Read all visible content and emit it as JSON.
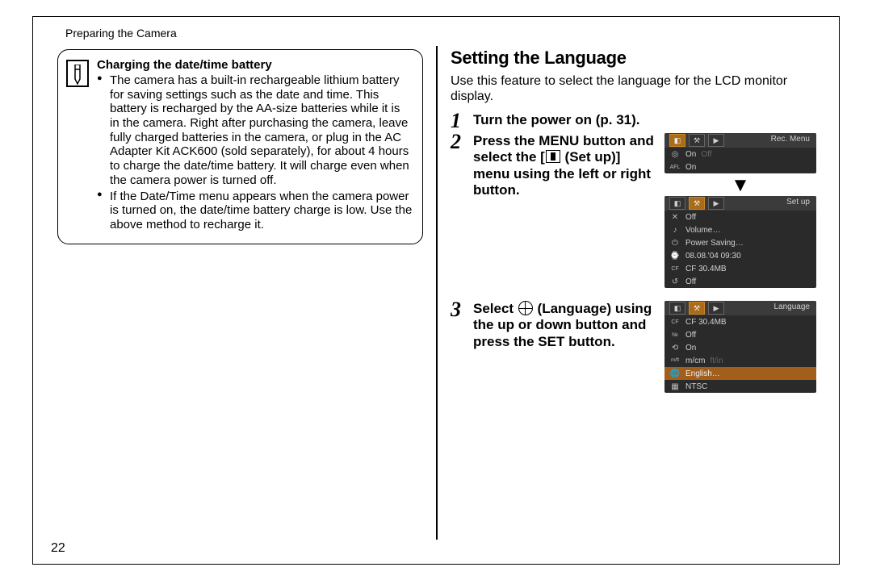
{
  "header": "Preparing the Camera",
  "page_number": "22",
  "note": {
    "title": "Charging the date/time battery",
    "items": [
      "The camera has a built-in rechargeable lithium battery for saving settings such as the date and time. This battery is recharged by the AA-size batteries while it is in the camera. Right after purchasing the camera, leave fully charged batteries in the camera, or plug in the AC Adapter Kit ACK600 (sold separately), for about 4 hours to charge the date/time battery. It will charge even when the camera power is turned off.",
      "If the Date/Time menu appears when the camera power is turned on, the date/time battery charge is low. Use the above method to recharge it."
    ]
  },
  "section_heading": "Setting the Language",
  "intro": "Use this feature to select the language for the LCD monitor display.",
  "steps": {
    "s1": "Turn the power on (p. 31).",
    "s2_before": "Press the MENU button and select the [",
    "s2_after": " (Set up)] menu using the left or right button.",
    "s3_before": "Select ",
    "s3_after": " (Language) using the up or down button and press the SET button."
  },
  "lcd1": {
    "title": "Rec. Menu",
    "rows": [
      {
        "icon": "◎",
        "val": "On",
        "dim": "Off"
      },
      {
        "icon": "AFL",
        "val": "On",
        "dim": ""
      }
    ]
  },
  "lcd2": {
    "title": "Set up",
    "rows": [
      {
        "icon": "✕",
        "val": "Off"
      },
      {
        "icon": "♪",
        "val": "Volume…"
      },
      {
        "icon": "⏻",
        "val": "Power Saving…"
      },
      {
        "icon": "⌚",
        "val": "08.08.'04 09:30"
      },
      {
        "icon": "CF",
        "val": "CF 30.4MB"
      },
      {
        "icon": "↺",
        "val": "Off"
      }
    ]
  },
  "lcd3": {
    "title": "Language",
    "rows": [
      {
        "icon": "CF",
        "val": "CF 30.4MB"
      },
      {
        "icon": "№",
        "val": "Off"
      },
      {
        "icon": "⟲",
        "val": "On"
      },
      {
        "icon": "m/ft",
        "val": "m/cm",
        "dim": "ft/in"
      },
      {
        "icon": "🌐",
        "val": "English…",
        "hl": true
      },
      {
        "icon": "▦",
        "val": "NTSC"
      }
    ]
  }
}
